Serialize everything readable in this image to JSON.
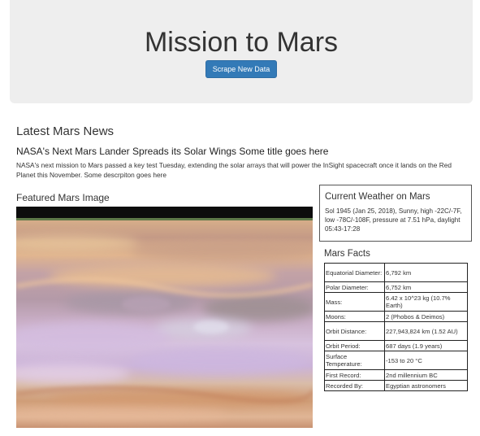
{
  "header": {
    "title": "Mission to Mars",
    "scrape_label": "Scrape New Data"
  },
  "news": {
    "heading": "Latest Mars News",
    "title": "NASA's Next Mars Lander Spreads its Solar Wings Some title goes here",
    "paragraph": "NASA's next mission to Mars passed a key test Tuesday, extending the solar arrays that will power the InSight spacecraft once it lands on the Red Planet this November. Some descrpiton goes here"
  },
  "featured": {
    "heading": "Featured Mars Image"
  },
  "weather": {
    "heading": "Current Weather on Mars",
    "text": "Sol 1945 (Jan 25, 2018), Sunny, high -22C/-7F, low -78C/-108F, pressure at 7.51 hPa, daylight 05:43-17:28"
  },
  "facts": {
    "heading": "Mars Facts",
    "rows": [
      {
        "key": "Equatorial Diameter:",
        "value": "6,792 km"
      },
      {
        "key": "Polar Diameter:",
        "value": "6,752 km"
      },
      {
        "key": "Mass:",
        "value": "6.42 x 10^23 kg (10.7% Earth)"
      },
      {
        "key": "Moons:",
        "value": "2 (Phobos & Deimos)"
      },
      {
        "key": "Orbit Distance:",
        "value": "227,943,824 km (1.52 AU)"
      },
      {
        "key": "Orbit Period:",
        "value": "687 days (1.9 years)"
      },
      {
        "key": "Surface Temperature:",
        "value": "-153 to 20 °C"
      },
      {
        "key": "First Record:",
        "value": "2nd millennium BC"
      },
      {
        "key": "Recorded By:",
        "value": "Egyptian astronomers"
      }
    ]
  }
}
